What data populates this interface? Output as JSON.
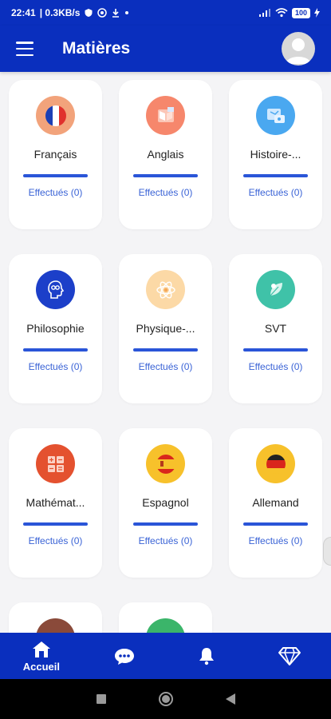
{
  "status_bar": {
    "time": "22:41",
    "speed": "| 0.3KB/s",
    "battery": "100"
  },
  "header": {
    "title": "Matières"
  },
  "subjects": [
    {
      "name": "Français",
      "progress_label": "Effectués (0)",
      "icon": "france-flag-icon",
      "color": "#f2a37b"
    },
    {
      "name": "Anglais",
      "progress_label": "Effectués (0)",
      "icon": "english-book-icon",
      "color": "#f6876c"
    },
    {
      "name": "Histoire-...",
      "progress_label": "Effectués (0)",
      "icon": "history-map-icon",
      "color": "#4aa8f0"
    },
    {
      "name": "Philosophie",
      "progress_label": "Effectués (0)",
      "icon": "philosophy-head-icon",
      "color": "#1c3fc9"
    },
    {
      "name": "Physique-...",
      "progress_label": "Effectués (0)",
      "icon": "physics-atom-icon",
      "color": "#fcd9a6"
    },
    {
      "name": "SVT",
      "progress_label": "Effectués (0)",
      "icon": "svt-leaf-icon",
      "color": "#3fc2a8"
    },
    {
      "name": "Mathémat...",
      "progress_label": "Effectués (0)",
      "icon": "math-calculator-icon",
      "color": "#e4512f"
    },
    {
      "name": "Espagnol",
      "progress_label": "Effectués (0)",
      "icon": "spain-flag-icon",
      "color": "#f7c12b"
    },
    {
      "name": "Allemand",
      "progress_label": "Effectués (0)",
      "icon": "germany-flag-icon",
      "color": "#f7c12b"
    },
    {
      "name": "",
      "progress_label": "",
      "icon": "subject-icon",
      "color": "#8a4a3a"
    },
    {
      "name": "",
      "progress_label": "",
      "icon": "subject-icon",
      "color": "#3bb56a"
    }
  ],
  "bottom_nav": {
    "home_label": "Accueil"
  },
  "colors": {
    "primary": "#0a2fbe",
    "progress_bar": "#2a55d8",
    "progress_text": "#3a63d6",
    "background": "#f4f4f6"
  }
}
